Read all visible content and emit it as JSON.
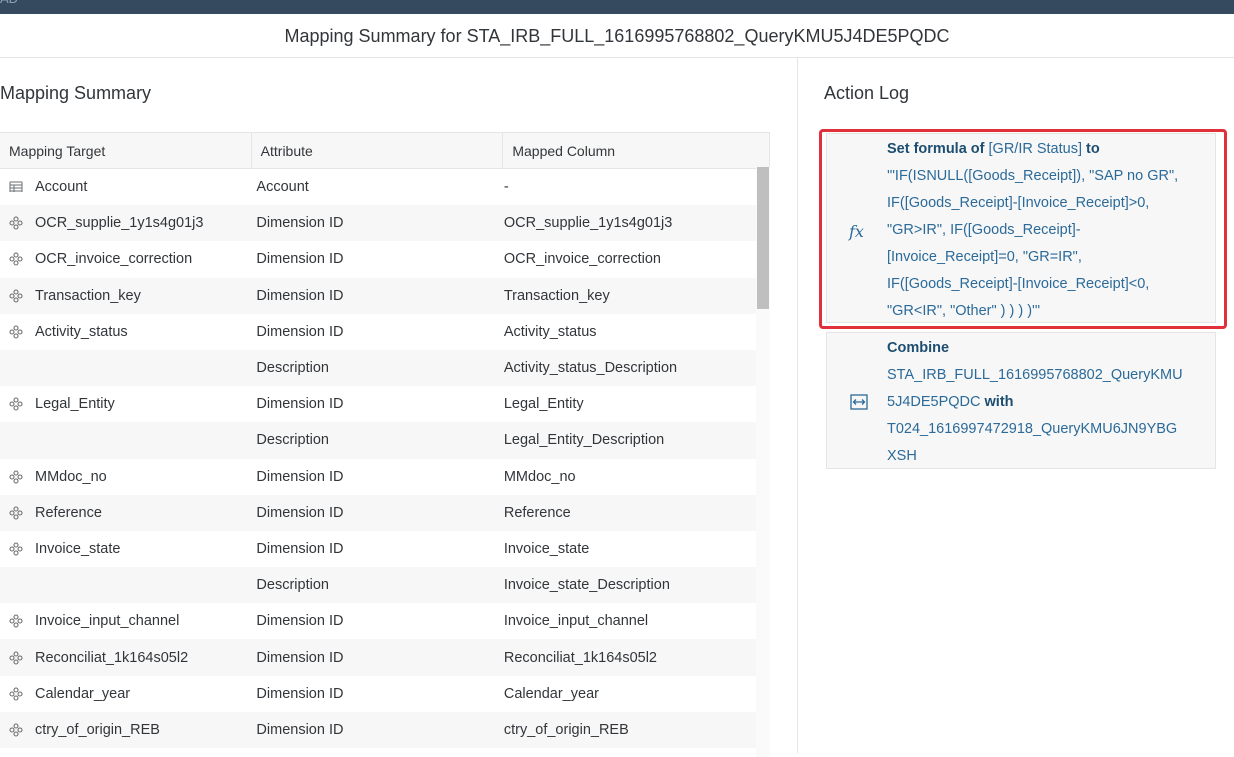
{
  "topbar": {
    "clipped_text": "AD"
  },
  "dialog": {
    "title": "Mapping Summary for STA_IRB_FULL_1616995768802_QueryKMU5J4DE5PQDC"
  },
  "mapping": {
    "title": "Mapping Summary",
    "columns": [
      "Mapping Target",
      "Attribute",
      "Mapped Column"
    ],
    "rows": [
      {
        "target": "Account",
        "icon": "account-icon",
        "attribute": "Account",
        "mapped": "-"
      },
      {
        "target": "OCR_supplie_1y1s4g01j3",
        "icon": "dimension-icon",
        "attribute": "Dimension ID",
        "mapped": "OCR_supplie_1y1s4g01j3"
      },
      {
        "target": "OCR_invoice_correction",
        "icon": "dimension-icon",
        "attribute": "Dimension ID",
        "mapped": "OCR_invoice_correction"
      },
      {
        "target": "Transaction_key",
        "icon": "dimension-icon",
        "attribute": "Dimension ID",
        "mapped": "Transaction_key"
      },
      {
        "target": "Activity_status",
        "icon": "dimension-icon",
        "attribute": "Dimension ID",
        "mapped": "Activity_status"
      },
      {
        "target": "",
        "icon": "",
        "attribute": "Description",
        "mapped": "Activity_status_Description"
      },
      {
        "target": "Legal_Entity",
        "icon": "dimension-icon",
        "attribute": "Dimension ID",
        "mapped": "Legal_Entity"
      },
      {
        "target": "",
        "icon": "",
        "attribute": "Description",
        "mapped": "Legal_Entity_Description"
      },
      {
        "target": "MMdoc_no",
        "icon": "dimension-icon",
        "attribute": "Dimension ID",
        "mapped": "MMdoc_no"
      },
      {
        "target": "Reference",
        "icon": "dimension-icon",
        "attribute": "Dimension ID",
        "mapped": "Reference"
      },
      {
        "target": "Invoice_state",
        "icon": "dimension-icon",
        "attribute": "Dimension ID",
        "mapped": "Invoice_state"
      },
      {
        "target": "",
        "icon": "",
        "attribute": "Description",
        "mapped": "Invoice_state_Description"
      },
      {
        "target": "Invoice_input_channel",
        "icon": "dimension-icon",
        "attribute": "Dimension ID",
        "mapped": "Invoice_input_channel"
      },
      {
        "target": "Reconciliat_1k164s05l2",
        "icon": "dimension-icon",
        "attribute": "Dimension ID",
        "mapped": "Reconciliat_1k164s05l2"
      },
      {
        "target": "Calendar_year",
        "icon": "dimension-icon",
        "attribute": "Dimension ID",
        "mapped": "Calendar_year"
      },
      {
        "target": "ctry_of_origin_REB",
        "icon": "dimension-icon",
        "attribute": "Dimension ID",
        "mapped": "ctry_of_origin_REB"
      }
    ]
  },
  "action_log": {
    "title": "Action Log",
    "entries": [
      {
        "icon": "formula-icon",
        "icon_glyph": "fx",
        "action": "Set formula of",
        "subject": "[GR/IR Status]",
        "connector": "to",
        "lines": [
          "'\"IF(ISNULL([Goods_Receipt]), \"SAP no GR\",",
          "IF([Goods_Receipt]-[Invoice_Receipt]>0,",
          "\"GR>IR\", IF([Goods_Receipt]-",
          "[Invoice_Receipt]=0, \"GR=IR\",",
          "IF([Goods_Receipt]-[Invoice_Receipt]<0,",
          "\"GR<IR\", \"Other\" ) ) ) )'\""
        ]
      },
      {
        "icon": "combine-icon",
        "action": "Combine",
        "source_lines": [
          "STA_IRB_FULL_1616995768802_QueryKMU",
          "5J4DE5PQDC"
        ],
        "connector": "with",
        "target_lines": [
          "T024_1616997472918_QueryKMU6JN9YBG",
          "XSH"
        ]
      }
    ]
  },
  "colors": {
    "topbar": "#354a5f",
    "link": "#2b6a99",
    "highlight": "#e0303a",
    "row_alt": "#f7f7f7"
  }
}
